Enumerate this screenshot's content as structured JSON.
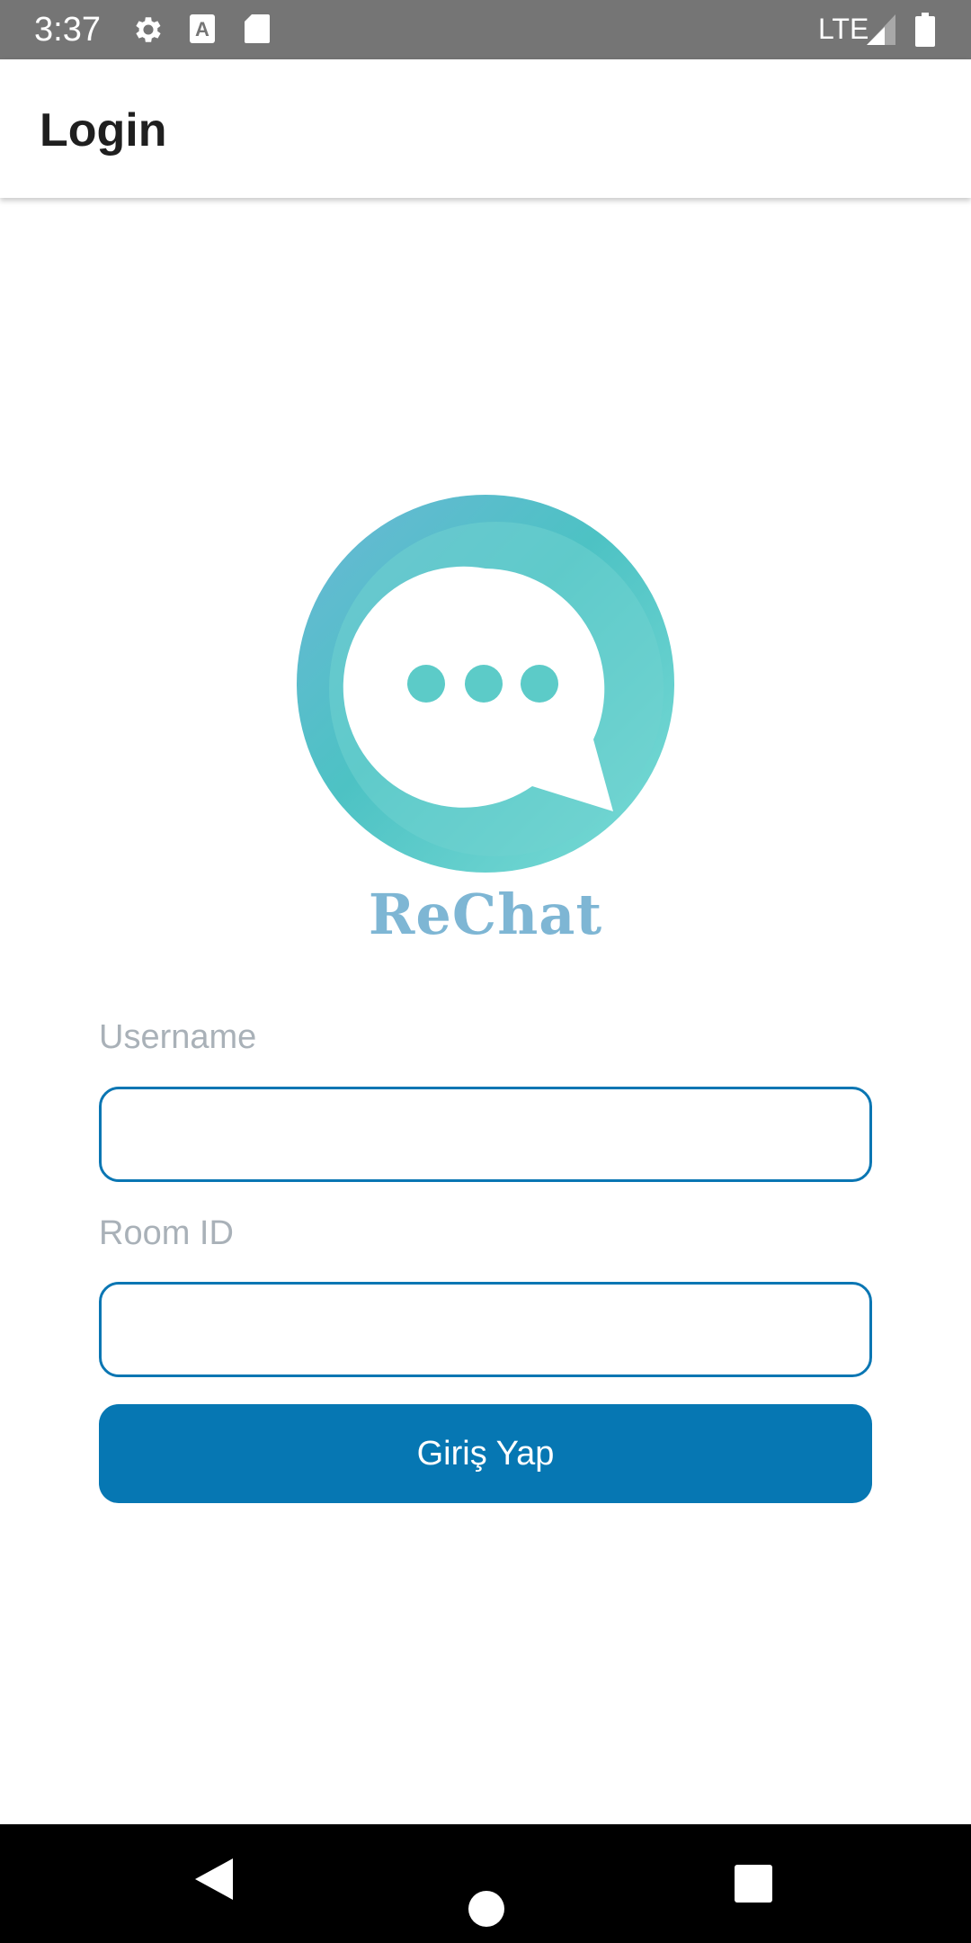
{
  "status_bar": {
    "time": "3:37",
    "network": "LTE",
    "icons": [
      "settings-icon",
      "keyboard-a-icon",
      "sd-card-icon",
      "signal-icon",
      "battery-icon"
    ]
  },
  "app_bar": {
    "title": "Login"
  },
  "logo": {
    "text": "ReChat",
    "colors": {
      "ring": "#4fc3c8",
      "text": "#7eb6d4"
    }
  },
  "form": {
    "username": {
      "label": "Username",
      "value": "",
      "placeholder": ""
    },
    "room_id": {
      "label": "Room ID",
      "value": "",
      "placeholder": ""
    },
    "submit_label": "Giriş Yap"
  },
  "colors": {
    "accent": "#0677b3",
    "status_bar": "#757575",
    "nav_bar": "#000000"
  },
  "nav_bar": {
    "icons": [
      "back-icon",
      "home-icon",
      "recents-icon"
    ]
  }
}
